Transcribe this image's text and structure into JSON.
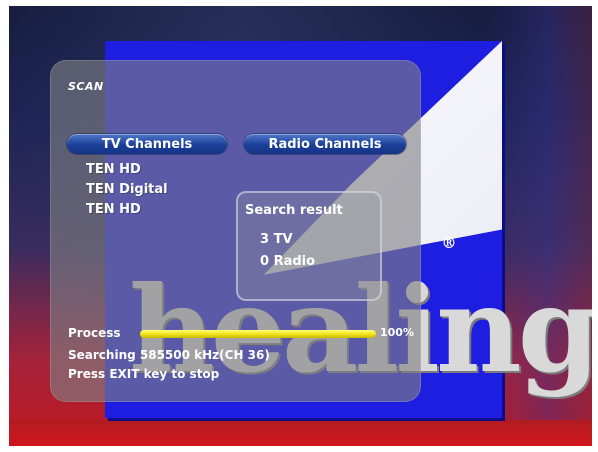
{
  "osd": {
    "title": "SCAN",
    "tabs": [
      {
        "label": "TV Channels",
        "selected": true
      },
      {
        "label": "Radio Channels",
        "selected": false
      }
    ],
    "tv_channels": [
      "TEN HD",
      "TEN Digital",
      "TEN HD"
    ],
    "search_result": {
      "title": "Search result",
      "tv": "3 TV",
      "radio": "0 Radio"
    },
    "process": {
      "label": "Process",
      "percent_text": "100%",
      "progress": 1.0
    },
    "status": {
      "searching": "Searching 585500 kHz(CH 36)",
      "hint": "Press EXIT key to stop"
    }
  },
  "brand": {
    "wordmark": "healing",
    "registered_mark": "®"
  },
  "colors": {
    "logo_blue": "#1e1ee0",
    "tab_blue": "#1b3f9a",
    "progress_yellow": "#f2e31e",
    "bottom_red": "#c01820"
  }
}
